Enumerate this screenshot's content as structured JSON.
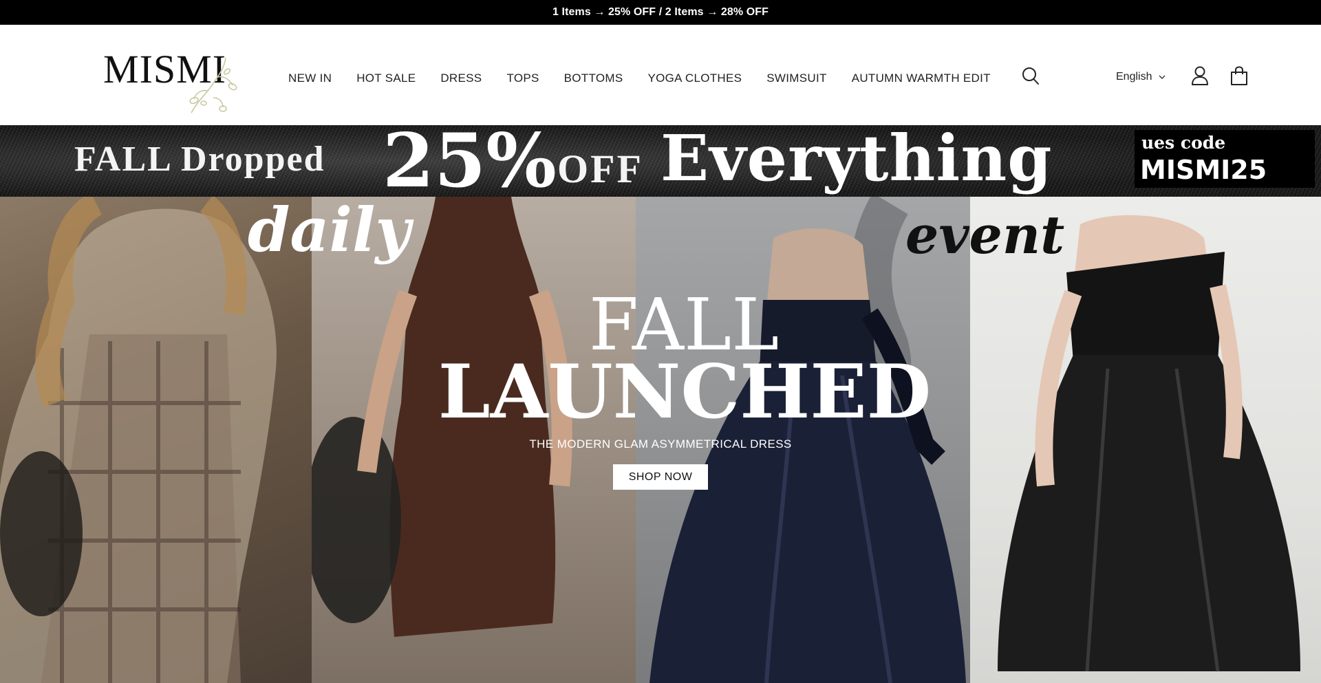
{
  "announcement": "1 Items → 25% OFF / 2 Items → 28% OFF",
  "brand": {
    "name": "MISMI"
  },
  "nav": [
    "NEW IN",
    "HOT SALE",
    "DRESS",
    "TOPS",
    "BOTTOMS",
    "YOGA CLOTHES",
    "SWIMSUIT",
    "AUTUMN WARMTH EDIT"
  ],
  "header_actions": {
    "search_icon": "search-icon",
    "language": "English",
    "account_icon": "user-icon",
    "bag_icon": "shopping-bag-icon"
  },
  "promo": {
    "lead": "FALL Dropped",
    "percent": "25%",
    "off": "OFF",
    "everything": "Everything",
    "code_label": "ues code",
    "code": "MISMI25"
  },
  "hero": {
    "word_left": "daily",
    "word_right": "event",
    "title_line1": "FALL",
    "title_line2": "LAUNCHED",
    "subtitle": "THE MODERN GLAM ASYMMETRICAL DRESS",
    "cta": "SHOP NOW"
  },
  "colors": {
    "announcement_bg": "#000000",
    "text": "#111111",
    "promo_code_bg": "#000000"
  }
}
